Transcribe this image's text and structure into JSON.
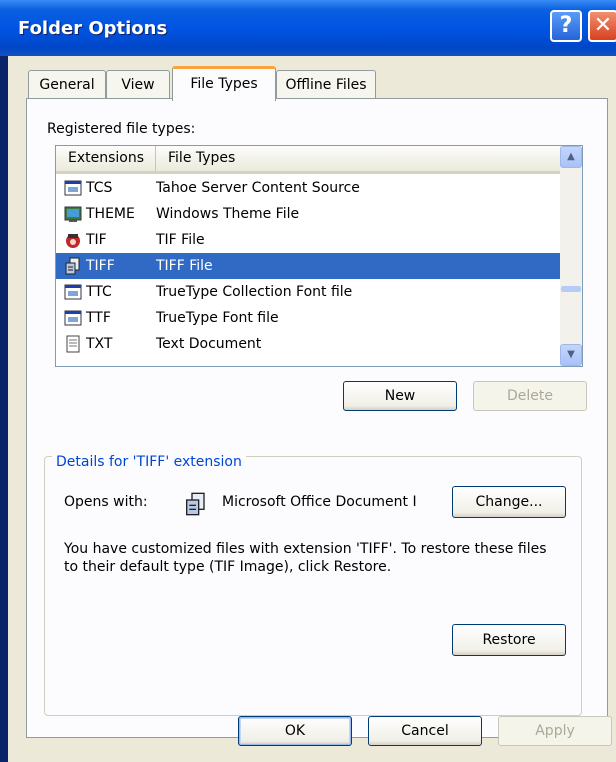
{
  "window": {
    "title": "Folder Options"
  },
  "tabs": [
    {
      "label": "General"
    },
    {
      "label": "View"
    },
    {
      "label": "File Types",
      "active": true
    },
    {
      "label": "Offline Files"
    }
  ],
  "registered_label": "Registered file types:",
  "file_list": {
    "columns": [
      "Extensions",
      "File Types"
    ],
    "rows": [
      {
        "ext": "TCS",
        "type": "Tahoe Server Content Source",
        "icon": "app-window-icon"
      },
      {
        "ext": "THEME",
        "type": "Windows Theme File",
        "icon": "theme-icon"
      },
      {
        "ext": "TIF",
        "type": "TIF File",
        "icon": "tif-image-icon"
      },
      {
        "ext": "TIFF",
        "type": "TIFF File",
        "icon": "office-document-imaging-icon",
        "selected": true
      },
      {
        "ext": "TTC",
        "type": "TrueType Collection Font file",
        "icon": "app-window-icon"
      },
      {
        "ext": "TTF",
        "type": "TrueType Font file",
        "icon": "app-window-icon"
      },
      {
        "ext": "TXT",
        "type": "Text Document",
        "icon": "text-document-icon"
      }
    ]
  },
  "buttons": {
    "new": "New",
    "delete": "Delete",
    "change": "Change...",
    "restore": "Restore",
    "ok": "OK",
    "cancel": "Cancel",
    "apply": "Apply"
  },
  "details": {
    "legend": "Details for 'TIFF' extension",
    "opens_with_label": "Opens with:",
    "opens_with_app": "Microsoft Office Document I",
    "description": "You have customized files with extension 'TIFF'.  To restore these files to their default type (TIF Image), click Restore."
  },
  "colors": {
    "selection": "#316ac5",
    "title_bar": "#0054e3",
    "group_legend": "#0046d5"
  }
}
